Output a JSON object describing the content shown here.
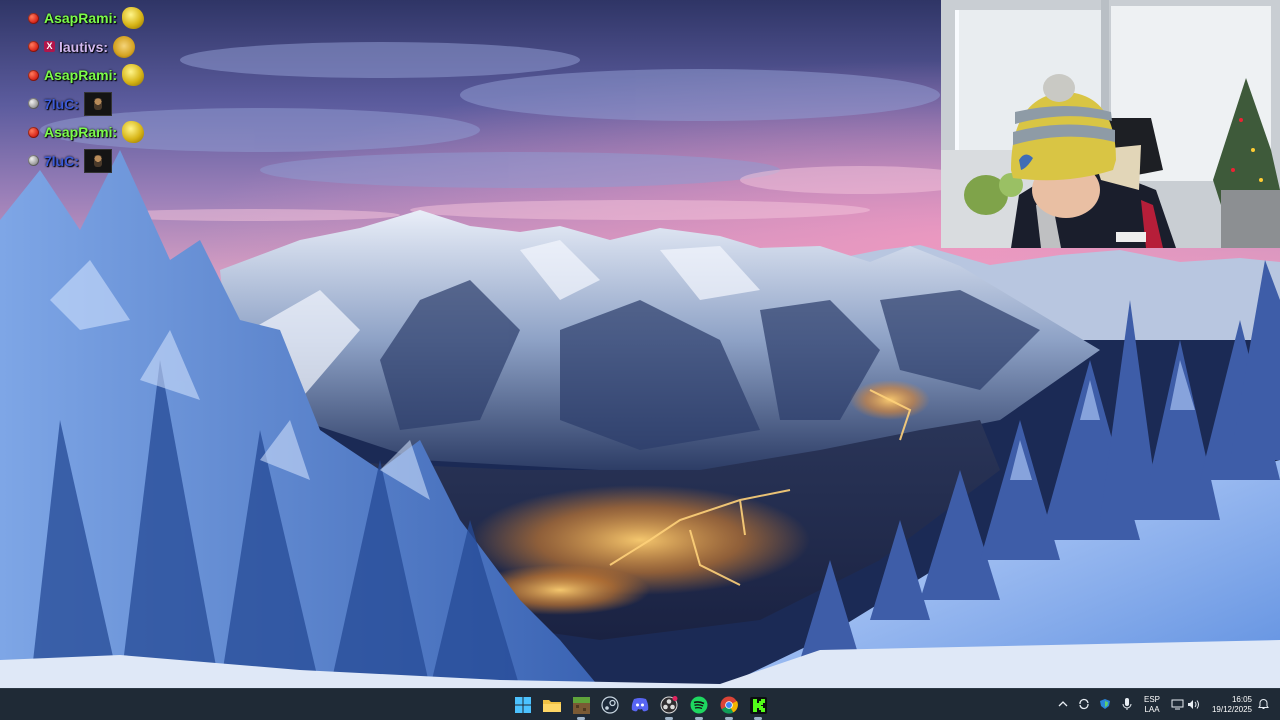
{
  "chat": {
    "messages": [
      {
        "user": "AsapRami:",
        "color": "#7CFC4A",
        "dot": "red",
        "emote": "gold-pepe-emote"
      },
      {
        "user": "lautivs:",
        "color": "#D2B8F0",
        "dot": "red",
        "badge": "X",
        "emote": "cat-emote"
      },
      {
        "user": "AsapRami:",
        "color": "#7CFC4A",
        "dot": "red",
        "emote": "gold-pepe-emote"
      },
      {
        "user": "7luC:",
        "color": "#3D5BD8",
        "dot": "gray",
        "emote": "dark-portrait-emote"
      },
      {
        "user": "AsapRami:",
        "color": "#7CFC4A",
        "dot": "red",
        "emote": "gold-pepe-emote"
      },
      {
        "user": "7luC:",
        "color": "#3D5BD8",
        "dot": "gray",
        "emote": "dark-portrait-emote"
      }
    ]
  },
  "taskbar": {
    "apps": [
      {
        "name": "start-button",
        "icon": "windows-icon"
      },
      {
        "name": "file-explorer",
        "icon": "folder-icon"
      },
      {
        "name": "minecraft",
        "icon": "minecraft-icon"
      },
      {
        "name": "steam",
        "icon": "steam-icon"
      },
      {
        "name": "discord",
        "icon": "discord-icon"
      },
      {
        "name": "obs",
        "icon": "obs-icon"
      },
      {
        "name": "spotify",
        "icon": "spotify-icon"
      },
      {
        "name": "chrome",
        "icon": "chrome-icon"
      },
      {
        "name": "kick",
        "icon": "kick-icon"
      }
    ],
    "tray": {
      "language_line1": "ESP",
      "language_line2": "LAA",
      "time": "16:05",
      "date": "19/12/2025"
    }
  },
  "colors": {
    "taskbar_bg": "#1f2a36",
    "sky_top": "#3b3f7a",
    "sky_pink": "#e889b8",
    "snow": "#dfe8f7"
  }
}
